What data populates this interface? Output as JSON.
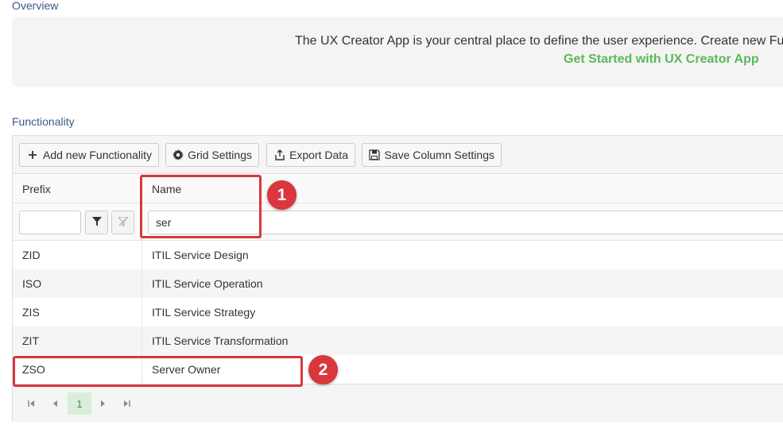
{
  "overview": {
    "label": "Overview",
    "text": "The UX Creator App is your central place to define the user experience. Create new Fu",
    "link": "Get Started with UX Creator App"
  },
  "functionality": {
    "label": "Functionality",
    "toolbar": {
      "add_label": "Add new Functionality",
      "grid_settings_label": "Grid Settings",
      "export_label": "Export Data",
      "save_columns_label": "Save Column Settings"
    },
    "columns": {
      "prefix": "Prefix",
      "name": "Name"
    },
    "filters": {
      "prefix_value": "",
      "name_value": "ser"
    },
    "rows": [
      {
        "prefix": "ZID",
        "name": "ITIL Service Design"
      },
      {
        "prefix": "ISO",
        "name": "ITIL Service Operation"
      },
      {
        "prefix": "ZIS",
        "name": "ITIL Service Strategy"
      },
      {
        "prefix": "ZIT",
        "name": "ITIL Service Transformation"
      },
      {
        "prefix": "ZSO",
        "name": "Server Owner"
      }
    ],
    "pager": {
      "current_page": "1"
    }
  },
  "annotations": [
    {
      "number": "1"
    },
    {
      "number": "2"
    }
  ],
  "colors": {
    "accent_link": "#5cb85c",
    "section_label": "#3b5a8a",
    "highlight": "#d9363e",
    "pager_current_bg": "#d9eed9"
  },
  "icons": {
    "add": "plus-icon",
    "grid_settings": "gear-icon",
    "export": "export-icon",
    "save": "floppy-disk-icon",
    "filter": "filter-icon",
    "clear_filter": "clear-filter-icon",
    "pager": [
      "first-page-icon",
      "prev-page-icon",
      "next-page-icon",
      "last-page-icon"
    ]
  }
}
